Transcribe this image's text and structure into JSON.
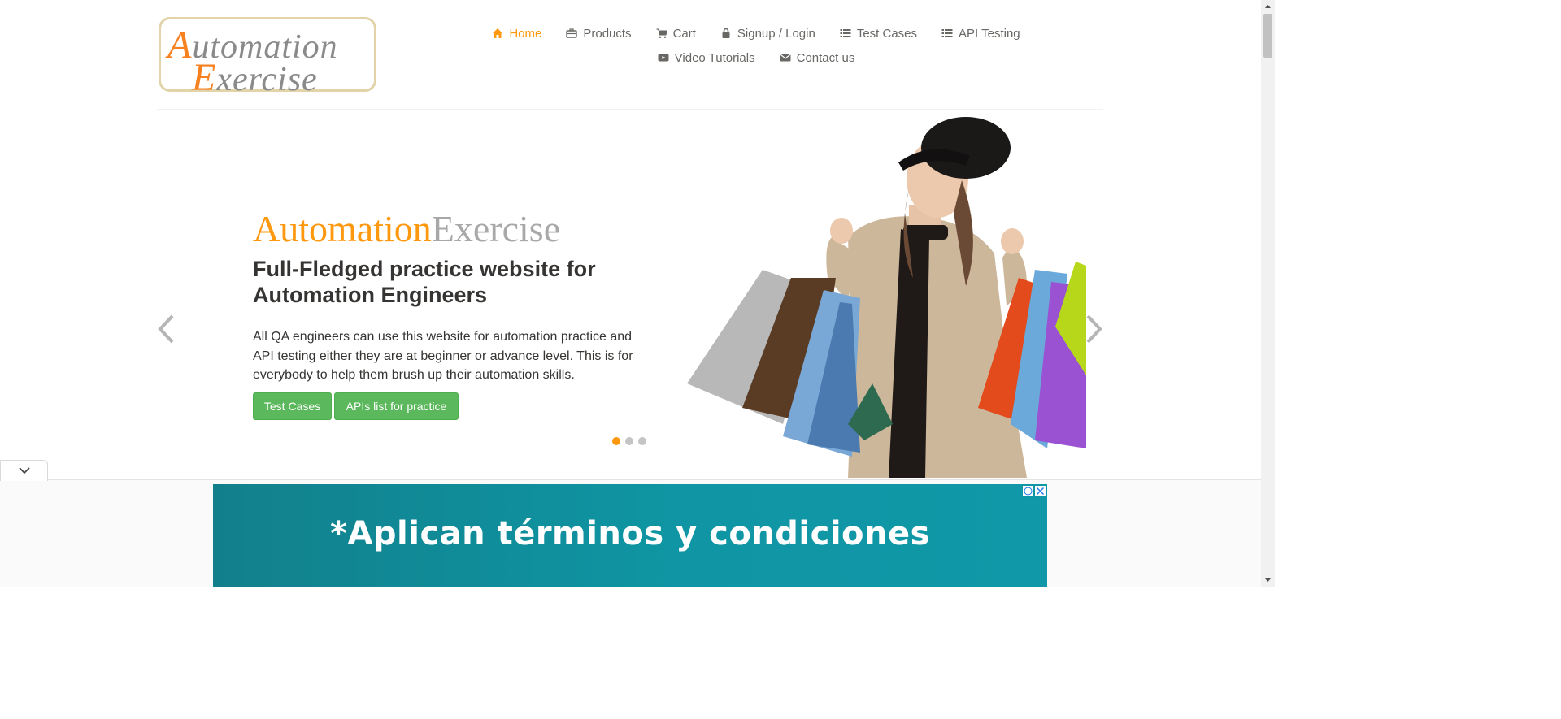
{
  "logo": {
    "line1_cap": "A",
    "line1_rest": "utomation",
    "line2_cap": "E",
    "line2_rest": "xercise"
  },
  "nav": {
    "items": [
      {
        "label": "Home",
        "icon": "home-icon",
        "active": true
      },
      {
        "label": "Products",
        "icon": "briefcase-icon"
      },
      {
        "label": "Cart",
        "icon": "cart-icon"
      },
      {
        "label": "Signup / Login",
        "icon": "lock-icon"
      },
      {
        "label": "Test Cases",
        "icon": "list-icon"
      },
      {
        "label": "API Testing",
        "icon": "list-icon"
      },
      {
        "label": "Video Tutorials",
        "icon": "youtube-play-icon"
      },
      {
        "label": "Contact us",
        "icon": "envelope-icon"
      }
    ]
  },
  "slider": {
    "brand_part1": "Automation",
    "brand_part2": "Exercise",
    "headline": "Full-Fledged practice website for Automation Engineers",
    "description": "All QA engineers can use this website for automation practice and API testing either they are at beginner or advance level. This is for everybody to help them brush up their automation skills.",
    "btn_test_cases": "Test Cases",
    "btn_apis": "APIs list for practice",
    "active_slide": 1,
    "slide_count": 3
  },
  "ad": {
    "text": "*Aplican términos y condiciones",
    "info_icon": "info-icon",
    "close_icon": "close-icon"
  },
  "colors": {
    "accent": "#fe980f",
    "button": "#5cb85c",
    "ad_bg": "#0f95a3"
  }
}
